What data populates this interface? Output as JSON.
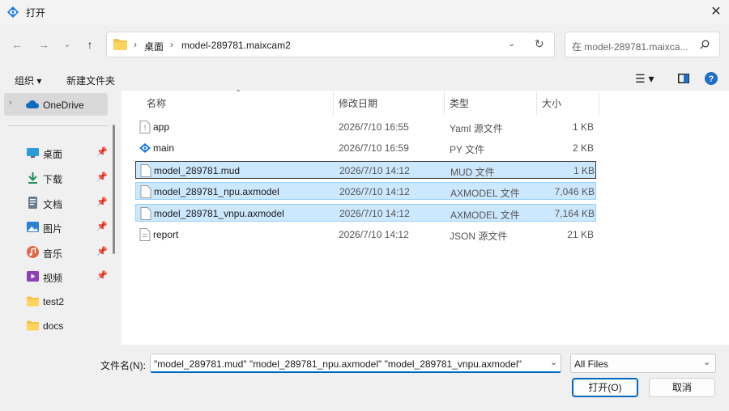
{
  "window": {
    "title": "打开"
  },
  "address": {
    "segments": [
      "桌面",
      "model-289781.maixcam2"
    ],
    "separator": "›"
  },
  "search": {
    "placeholder": "在 model-289781.maixcam2 中搜索",
    "display": "在 model-289781.maixca..."
  },
  "toolbar": {
    "organize": "组织",
    "new_folder": "新建文件夹"
  },
  "sidebar": {
    "onedrive": "OneDrive",
    "items": [
      {
        "label": "桌面",
        "icon": "desktop-icon",
        "pinned": true
      },
      {
        "label": "下载",
        "icon": "download-icon",
        "pinned": true
      },
      {
        "label": "文档",
        "icon": "document-icon",
        "pinned": true
      },
      {
        "label": "图片",
        "icon": "picture-icon",
        "pinned": true
      },
      {
        "label": "音乐",
        "icon": "music-icon",
        "pinned": true
      },
      {
        "label": "视频",
        "icon": "video-icon",
        "pinned": true
      },
      {
        "label": "test2",
        "icon": "folder-icon",
        "pinned": false
      },
      {
        "label": "docs",
        "icon": "folder-icon",
        "pinned": false
      }
    ]
  },
  "columns": {
    "name": "名称",
    "date": "修改日期",
    "type": "类型",
    "size": "大小"
  },
  "files": [
    {
      "name": "app",
      "date": "2026/7/10 16:55",
      "type": "Yaml 源文件",
      "size": "1 KB",
      "icon": "yaml-file-icon",
      "selected": false
    },
    {
      "name": "main",
      "date": "2026/7/10 16:59",
      "type": "PY 文件",
      "size": "2 KB",
      "icon": "python-file-icon",
      "selected": false
    },
    {
      "name": "model_289781.mud",
      "date": "2026/7/10 14:12",
      "type": "MUD 文件",
      "size": "1 KB",
      "icon": "file-icon",
      "selected": true
    },
    {
      "name": "model_289781_npu.axmodel",
      "date": "2026/7/10 14:12",
      "type": "AXMODEL 文件",
      "size": "7,046 KB",
      "icon": "file-icon",
      "selected": true
    },
    {
      "name": "model_289781_vnpu.axmodel",
      "date": "2026/7/10 14:12",
      "type": "AXMODEL 文件",
      "size": "7,164 KB",
      "icon": "file-icon",
      "selected": true
    },
    {
      "name": "report",
      "date": "2026/7/10 14:12",
      "type": "JSON 源文件",
      "size": "21 KB",
      "icon": "json-file-icon",
      "selected": false
    }
  ],
  "filename": {
    "label": "文件名(N):",
    "value": "\"model_289781.mud\" \"model_289781_npu.axmodel\" \"model_289781_vnpu.axmodel\""
  },
  "filetype": {
    "value": "All Files"
  },
  "buttons": {
    "open": "打开(O)",
    "cancel": "取消"
  },
  "colors": {
    "selection_bg": "#cce8ff",
    "selection_border": "#99d1ff",
    "accent": "#0067c0"
  }
}
